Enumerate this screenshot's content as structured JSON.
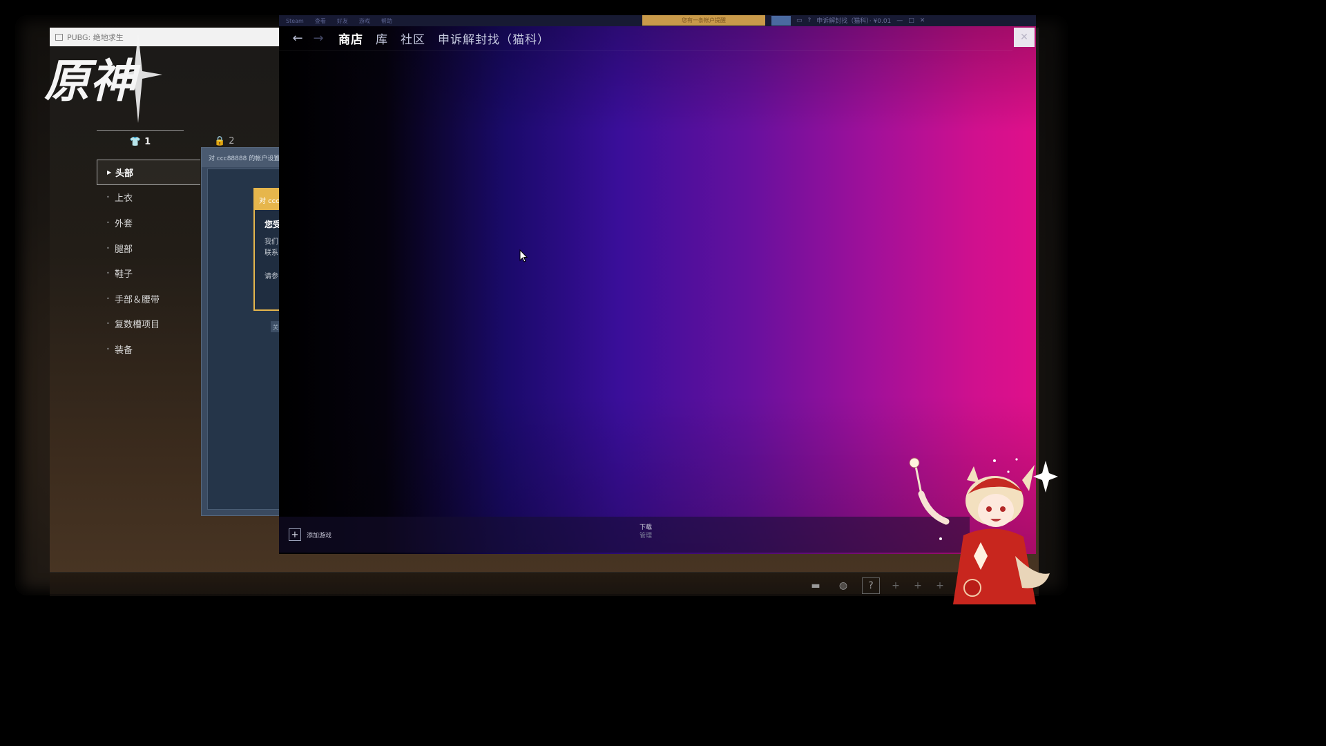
{
  "game_window": {
    "title": "PUBG: 绝地求生",
    "logo_text": "原神",
    "tabs": [
      {
        "label": "1",
        "icon": "shirt-icon",
        "active": true
      },
      {
        "label": "2",
        "icon": "lock-icon",
        "active": false
      }
    ],
    "categories": [
      {
        "label": "头部",
        "active": true
      },
      {
        "label": "上衣",
        "active": false
      },
      {
        "label": "外套",
        "active": false
      },
      {
        "label": "腿部",
        "active": false
      },
      {
        "label": "鞋子",
        "active": false
      },
      {
        "label": "手部＆腰带",
        "active": false
      },
      {
        "label": "复数槽项目",
        "active": false
      },
      {
        "label": "装备",
        "active": false
      }
    ],
    "hud_icons": [
      "chat-icon",
      "globe-icon",
      "help-icon",
      "plus-icon",
      "plus-icon",
      "plus-icon"
    ]
  },
  "support_dialog": {
    "header": "对 ccc88888 的帐户设置",
    "warning_header": "对 ccc",
    "warning_title": "您受",
    "lines": [
      "我们",
      "联系",
      "请参"
    ],
    "button": "关"
  },
  "steam": {
    "top_strip": [
      "Steam",
      "查看",
      "好友",
      "游戏",
      "帮助"
    ],
    "notification": "您有一条帐户提醒",
    "account_text": "申诉解封找（猫科）· ¥0.01",
    "nav": {
      "back_icon": "arrow-left-icon",
      "forward_icon": "arrow-right-icon",
      "links": [
        {
          "label": "商店",
          "active": true
        },
        {
          "label": "库",
          "active": false
        },
        {
          "label": "社区",
          "active": false
        },
        {
          "label": "申诉解封找（猫科）",
          "active": false
        }
      ]
    },
    "close_icon": "close-icon",
    "bottom": {
      "add_game": "添加游戏",
      "downloads": "下载",
      "downloads_sub": "管理"
    }
  },
  "colors": {
    "gradient_left": "#000000",
    "gradient_mid": "#3a0e9a",
    "gradient_right": "#e0108a",
    "warning_yellow": "#e6b64c"
  }
}
